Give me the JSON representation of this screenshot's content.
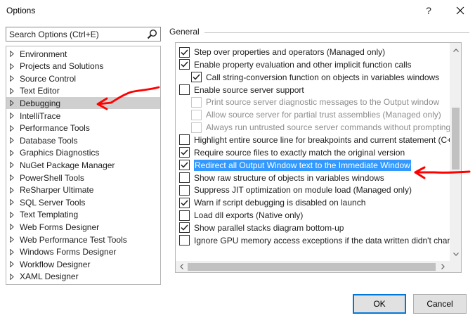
{
  "window": {
    "title": "Options",
    "help_label": "?"
  },
  "search": {
    "placeholder": "Search Options (Ctrl+E)"
  },
  "tree": {
    "items": [
      {
        "label": "Environment"
      },
      {
        "label": "Projects and Solutions"
      },
      {
        "label": "Source Control"
      },
      {
        "label": "Text Editor"
      },
      {
        "label": "Debugging",
        "selected": true
      },
      {
        "label": "IntelliTrace"
      },
      {
        "label": "Performance Tools"
      },
      {
        "label": "Database Tools"
      },
      {
        "label": "Graphics Diagnostics"
      },
      {
        "label": "NuGet Package Manager"
      },
      {
        "label": "PowerShell Tools"
      },
      {
        "label": "ReSharper Ultimate"
      },
      {
        "label": "SQL Server Tools"
      },
      {
        "label": "Text Templating"
      },
      {
        "label": "Web Forms Designer"
      },
      {
        "label": "Web Performance Test Tools"
      },
      {
        "label": "Windows Forms Designer"
      },
      {
        "label": "Workflow Designer"
      },
      {
        "label": "XAML Designer"
      }
    ]
  },
  "group": {
    "label": "General"
  },
  "options": [
    {
      "label": "Step over properties and operators (Managed only)",
      "checked": true,
      "disabled": false,
      "indent": 0
    },
    {
      "label": "Enable property evaluation and other implicit function calls",
      "checked": true,
      "disabled": false,
      "indent": 0
    },
    {
      "label": "Call string-conversion function on objects in variables windows",
      "checked": true,
      "disabled": false,
      "indent": 1
    },
    {
      "label": "Enable source server support",
      "checked": false,
      "disabled": false,
      "indent": 0
    },
    {
      "label": "Print source server diagnostic messages to the Output window",
      "checked": false,
      "disabled": true,
      "indent": 1
    },
    {
      "label": "Allow source server for partial trust assemblies (Managed only)",
      "checked": false,
      "disabled": true,
      "indent": 1
    },
    {
      "label": "Always run untrusted source server commands without prompting",
      "checked": false,
      "disabled": true,
      "indent": 1
    },
    {
      "label": "Highlight entire source line for breakpoints and current statement (C++",
      "checked": false,
      "disabled": false,
      "indent": 0
    },
    {
      "label": "Require source files to exactly match the original version",
      "checked": true,
      "disabled": false,
      "indent": 0
    },
    {
      "label": "Redirect all Output Window text to the Immediate Window",
      "checked": true,
      "disabled": false,
      "indent": 0,
      "highlighted": true
    },
    {
      "label": "Show raw structure of objects in variables windows",
      "checked": false,
      "disabled": false,
      "indent": 0
    },
    {
      "label": "Suppress JIT optimization on module load (Managed only)",
      "checked": false,
      "disabled": false,
      "indent": 0
    },
    {
      "label": "Warn if script debugging is disabled on launch",
      "checked": true,
      "disabled": false,
      "indent": 0
    },
    {
      "label": "Load dll exports (Native only)",
      "checked": false,
      "disabled": false,
      "indent": 0
    },
    {
      "label": "Show parallel stacks diagram bottom-up",
      "checked": true,
      "disabled": false,
      "indent": 0
    },
    {
      "label": "Ignore GPU memory access exceptions if the data written didn't chang",
      "checked": false,
      "disabled": false,
      "indent": 0
    }
  ],
  "buttons": {
    "ok": "OK",
    "cancel": "Cancel"
  },
  "colors": {
    "selection": "#3399ff",
    "annotation": "#ff0000",
    "ok_border": "#0078d7"
  },
  "icons": {
    "search": "search-icon",
    "close": "close-icon",
    "expand": "triangle-right-icon",
    "check": "check-icon"
  }
}
